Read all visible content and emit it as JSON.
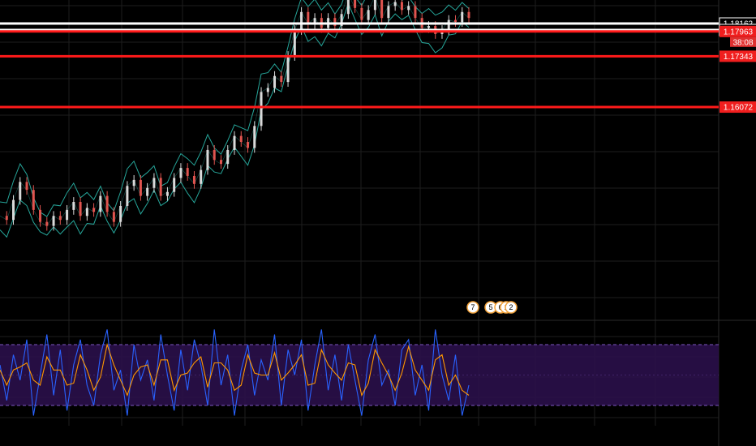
{
  "colors": {
    "background": "#000000",
    "grid": "#1e1e1e",
    "bollinger": "#26a69a",
    "candle_up": "#d9d9d9",
    "candle_down": "#e0544f",
    "support_line": "#ff1a1a",
    "white_line": "#ffffff",
    "stoch_k": "#2962ff",
    "stoch_d": "#ff9800",
    "stoch_band_fill": "#2a0f4a",
    "stoch_band_edge": "#7e57c2"
  },
  "chart_data": [
    {
      "type": "line",
      "title": "",
      "description_series": "price",
      "ylim": [
        1.108,
        1.1875
      ],
      "grid": true,
      "price_levels": [
        {
          "value": 1.18162,
          "label": "1.18162",
          "style": "white"
        },
        {
          "value": 1.18,
          "label": "1.18000",
          "style": "white"
        },
        {
          "value": 1.17963,
          "label": "1.17963",
          "style": "red"
        },
        {
          "value": 1.17343,
          "label": "1.17343",
          "style": "red"
        },
        {
          "value": 1.16072,
          "label": "1.16072",
          "style": "red"
        }
      ],
      "countdown": "38:08",
      "x": [
        0,
        2,
        4,
        6,
        8,
        10,
        12,
        14,
        16,
        18,
        20,
        22,
        24,
        26,
        28,
        30,
        32,
        34,
        36,
        38,
        40,
        42,
        44,
        46,
        48,
        50,
        52,
        54,
        56,
        58,
        60,
        62,
        64,
        66,
        68,
        70,
        72,
        74,
        76,
        78,
        80,
        82,
        84,
        86,
        88,
        90,
        92,
        94,
        96,
        98,
        100,
        102,
        104,
        106,
        108,
        110,
        112,
        114,
        116,
        118,
        120,
        122,
        124,
        126,
        128,
        130,
        132,
        134,
        136,
        138,
        140
      ],
      "series": [
        {
          "values": [
            1.1335,
            1.1325,
            1.1375,
            1.142,
            1.14,
            1.135,
            1.132,
            1.131,
            1.1335,
            1.1325,
            1.135,
            1.137,
            1.1335,
            1.1355,
            1.1345,
            1.1385,
            1.1345,
            1.132,
            1.136,
            1.141,
            1.1425,
            1.1385,
            1.1405,
            1.143,
            1.1385,
            1.1395,
            1.143,
            1.1455,
            1.1435,
            1.1415,
            1.145,
            1.15,
            1.1475,
            1.1465,
            1.15,
            1.1535,
            1.152,
            1.1505,
            1.156,
            1.1645,
            1.1655,
            1.1685,
            1.167,
            1.1735,
            1.18,
            1.1845,
            1.1815,
            1.183,
            1.1805,
            1.183,
            1.181,
            1.184,
            1.189,
            1.1855,
            1.1825,
            1.185,
            1.1885,
            1.183,
            1.186,
            1.187,
            1.185,
            1.186,
            1.183,
            1.1805,
            1.181,
            1.179,
            1.18,
            1.1825,
            1.182,
            1.1845,
            1.183
          ]
        }
      ]
    },
    {
      "type": "line",
      "title": "",
      "ylim": [
        0,
        100
      ],
      "bands": [
        20,
        80
      ],
      "series": [
        {
          "values": [
            60,
            25,
            70,
            45,
            85,
            10,
            50,
            90,
            30,
            75,
            15,
            60,
            85,
            40,
            20,
            70,
            95,
            35,
            55,
            10,
            80,
            45,
            65,
            25,
            90,
            50,
            15,
            75,
            35,
            85,
            60,
            20,
            95,
            40,
            70,
            10,
            55,
            80,
            30,
            65,
            45,
            90,
            20,
            75,
            50,
            85,
            15,
            60,
            95,
            35,
            70,
            25,
            80,
            45,
            10,
            65,
            90,
            40,
            55,
            20,
            75,
            85,
            30,
            60,
            15,
            95,
            50,
            25,
            70,
            10,
            40
          ]
        },
        {
          "values": [
            55,
            40,
            55,
            58,
            62,
            45,
            40,
            68,
            55,
            55,
            40,
            42,
            70,
            55,
            35,
            48,
            80,
            60,
            45,
            30,
            50,
            58,
            60,
            40,
            65,
            65,
            35,
            50,
            52,
            62,
            68,
            38,
            62,
            62,
            55,
            35,
            40,
            70,
            52,
            50,
            50,
            72,
            45,
            52,
            60,
            70,
            40,
            42,
            75,
            60,
            52,
            45,
            62,
            60,
            30,
            42,
            75,
            62,
            50,
            35,
            52,
            78,
            55,
            45,
            35,
            65,
            70,
            40,
            50,
            35,
            30
          ]
        }
      ]
    }
  ],
  "event_markers": {
    "badges": [
      "7",
      "5",
      "6",
      "1",
      "2"
    ]
  }
}
